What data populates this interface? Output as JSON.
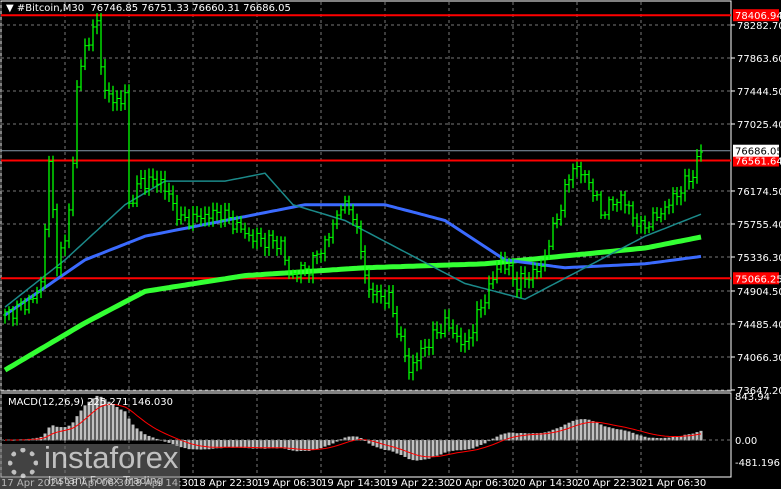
{
  "header": {
    "symbol": "#Bitcoin,M30",
    "ohlc": "76746.85 76751.33 76660.31 76686.05"
  },
  "macd": {
    "label": "MACD(12,26,9) 225.271 146.030",
    "axis": [
      "843.94",
      "0.00",
      "-481.196"
    ]
  },
  "watermark": {
    "brand": "instaforex",
    "tagline": "Instant Forex Trading"
  },
  "chart_data": {
    "type": "line",
    "title": "#Bitcoin,M30",
    "price_ticks": [
      78282.7,
      77863.6,
      77444.5,
      77025.4,
      76174.5,
      75755.4,
      75336.3,
      74904.5,
      74485.4,
      74066.3,
      73647.2
    ],
    "ylim": [
      73647.2,
      78406.94
    ],
    "levels": [
      {
        "value": 78406.94,
        "label": "78406.94",
        "color": "#ff0000"
      },
      {
        "value": 76561.64,
        "label": "76561.64",
        "color": "#ff0000"
      },
      {
        "value": 75066.25,
        "label": "75066.25",
        "color": "#ff0000"
      }
    ],
    "current_price": {
      "value": 76686.05,
      "label": "76686.05"
    },
    "time_labels": [
      "17 Apr 2024",
      "18 Apr 06:30",
      "18 Apr 14:30",
      "18 Apr 22:30",
      "19 Apr 06:30",
      "19 Apr 14:30",
      "19 Apr 22:30",
      "20 Apr 06:30",
      "20 Apr 14:30",
      "20 Apr 22:30",
      "21 Apr 06:30"
    ],
    "bars_per_label": 16,
    "price_path": [
      [
        0,
        74600
      ],
      [
        7,
        74800
      ],
      [
        9,
        75000
      ],
      [
        11,
        76500
      ],
      [
        13,
        75300
      ],
      [
        15,
        75500
      ],
      [
        17,
        76500
      ],
      [
        18,
        77500
      ],
      [
        20,
        78000
      ],
      [
        23,
        78300
      ],
      [
        25,
        77400
      ],
      [
        29,
        77300
      ],
      [
        30,
        77400
      ],
      [
        31,
        76000
      ],
      [
        34,
        76300
      ],
      [
        39,
        76300
      ],
      [
        44,
        75800
      ],
      [
        54,
        75900
      ],
      [
        61,
        75600
      ],
      [
        69,
        75500
      ],
      [
        71,
        75100
      ],
      [
        76,
        75200
      ],
      [
        81,
        75600
      ],
      [
        84,
        76000
      ],
      [
        87,
        75900
      ],
      [
        91,
        74900
      ],
      [
        96,
        74800
      ],
      [
        101,
        73900
      ],
      [
        105,
        74200
      ],
      [
        110,
        74500
      ],
      [
        115,
        74200
      ],
      [
        119,
        74700
      ],
      [
        124,
        75300
      ],
      [
        128,
        75000
      ],
      [
        134,
        75200
      ],
      [
        139,
        76000
      ],
      [
        142,
        76500
      ],
      [
        146,
        76300
      ],
      [
        149,
        75900
      ],
      [
        154,
        76100
      ],
      [
        159,
        75700
      ],
      [
        164,
        75900
      ],
      [
        169,
        76200
      ],
      [
        172,
        76400
      ],
      [
        174,
        76690
      ]
    ],
    "ma_fast": [
      [
        0,
        74700
      ],
      [
        15,
        75300
      ],
      [
        30,
        76000
      ],
      [
        40,
        76300
      ],
      [
        55,
        76300
      ],
      [
        65,
        76400
      ],
      [
        72,
        76000
      ],
      [
        85,
        75800
      ],
      [
        100,
        75400
      ],
      [
        115,
        75000
      ],
      [
        130,
        74800
      ],
      [
        145,
        75200
      ],
      [
        160,
        75600
      ],
      [
        175,
        75900
      ]
    ],
    "ma_mid": [
      [
        0,
        74600
      ],
      [
        20,
        75300
      ],
      [
        35,
        75600
      ],
      [
        55,
        75800
      ],
      [
        75,
        76000
      ],
      [
        95,
        76000
      ],
      [
        110,
        75800
      ],
      [
        125,
        75300
      ],
      [
        140,
        75200
      ],
      [
        160,
        75250
      ],
      [
        175,
        75350
      ]
    ],
    "ma_slow": [
      [
        0,
        73900
      ],
      [
        20,
        74500
      ],
      [
        35,
        74900
      ],
      [
        60,
        75100
      ],
      [
        90,
        75200
      ],
      [
        120,
        75250
      ],
      [
        140,
        75350
      ],
      [
        160,
        75450
      ],
      [
        175,
        75600
      ]
    ],
    "series_colors": {
      "bars": "#00ff00",
      "ma_fast": "#1b8a8a",
      "ma_mid": "#3b6bff",
      "ma_slow": "#33ff33",
      "signal": "#ff0000",
      "hist": "#c0c0c0"
    }
  }
}
